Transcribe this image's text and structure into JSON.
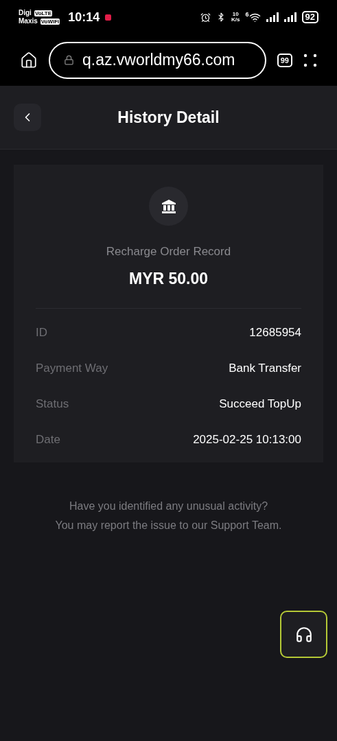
{
  "status_bar": {
    "carrier_1": "Digi",
    "carrier_1_badge": "VoLTE",
    "carrier_2": "Maxis",
    "carrier_2_badge": "VoWiFi",
    "time": "10:14",
    "speed_value": "10",
    "speed_unit": "K/s",
    "wifi_badge": "6",
    "battery": "92"
  },
  "browser": {
    "url": "q.az.vworldmy66.com",
    "tab_count": "99"
  },
  "header": {
    "title": "History Detail"
  },
  "record": {
    "type": "Recharge Order Record",
    "amount": "MYR 50.00",
    "fields": [
      {
        "label": "ID",
        "value": "12685954"
      },
      {
        "label": "Payment Way",
        "value": "Bank Transfer"
      },
      {
        "label": "Status",
        "value": "Succeed TopUp"
      },
      {
        "label": "Date",
        "value": "2025-02-25 10:13:00"
      }
    ]
  },
  "notice": [
    "Have you identified any unusual activity?",
    "You may report the issue to our Support Team."
  ]
}
